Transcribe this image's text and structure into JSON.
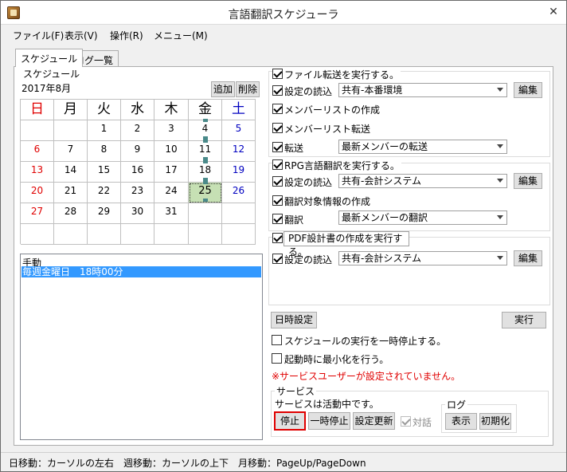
{
  "window": {
    "title": "言語翻訳スケジューラ",
    "close_glyph": "✕"
  },
  "menu": [
    "ファイル(F)",
    "表示(V)",
    "操作(R)",
    "メニュー(M)"
  ],
  "tabs": [
    "スケジュール",
    "ログ一覧"
  ],
  "schedule": {
    "group_label": "スケジュール",
    "month": "2017年8月",
    "add_button": "追加",
    "delete_button": "削除",
    "weekdays": [
      "日",
      "月",
      "火",
      "水",
      "木",
      "金",
      "土"
    ],
    "days": [
      [
        "",
        "",
        "1",
        "2",
        "3",
        "4",
        "5"
      ],
      [
        "6",
        "7",
        "8",
        "9",
        "10",
        "11",
        "12"
      ],
      [
        "13",
        "14",
        "15",
        "16",
        "17",
        "18",
        "19"
      ],
      [
        "20",
        "21",
        "22",
        "23",
        "24",
        "25",
        "26"
      ],
      [
        "27",
        "28",
        "29",
        "30",
        "31",
        "",
        ""
      ],
      [
        "",
        "",
        "",
        "",
        "",
        "",
        ""
      ]
    ],
    "selected_day": "25",
    "marked_days": [
      "4",
      "11",
      "18",
      "25"
    ]
  },
  "schedule_list": {
    "header": "手動",
    "items": [
      "毎週金曜日　18時00分"
    ]
  },
  "file_transfer": {
    "title": "ファイル転送を実行する。",
    "settings_label": "設定の読込",
    "settings_value": "共有-本番環境",
    "edit_button": "編集",
    "create_member_list": "メンバーリストの作成",
    "transfer_member_list": "メンバーリスト転送",
    "transfer_label": "転送",
    "transfer_value": "最新メンバーの転送"
  },
  "rpg_translation": {
    "title": "RPG言語翻訳を実行する。",
    "settings_label": "設定の読込",
    "settings_value": "共有-会計システム",
    "edit_button": "編集",
    "create_target_info": "翻訳対象情報の作成",
    "translate_label": "翻訳",
    "translate_value": "最新メンバーの翻訳"
  },
  "pdf_design": {
    "title": "PDF設計書の作成を実行する。",
    "settings_label": "設定の読込",
    "settings_value": "共有-会計システム",
    "edit_button": "編集"
  },
  "controls": {
    "datetime_button": "日時設定",
    "run_button": "実行",
    "pause_schedule": "スケジュールの実行を一時停止する。",
    "minimize_on_start": "起動時に最小化を行う。",
    "warning": "※サービスユーザーが設定されていません。"
  },
  "service": {
    "group_label": "サービス",
    "status": "サービスは活動中です。",
    "stop_button": "停止",
    "pause_button": "一時停止",
    "update_button": "設定更新",
    "interactive_label": "対話"
  },
  "log": {
    "group_label": "ログ",
    "show_button": "表示",
    "init_button": "初期化"
  },
  "statusbar": {
    "text": "日移動：カーソルの左右　週移動：カーソルの上下　月移動：PageUp/PageDown"
  },
  "colors": {
    "sunday": "#e00000",
    "saturday": "#0000c0",
    "selection": "#3399ff",
    "warning": "#e00000",
    "highlight_border": "#e00000",
    "selected_day_bg": "#c6e0b4"
  }
}
